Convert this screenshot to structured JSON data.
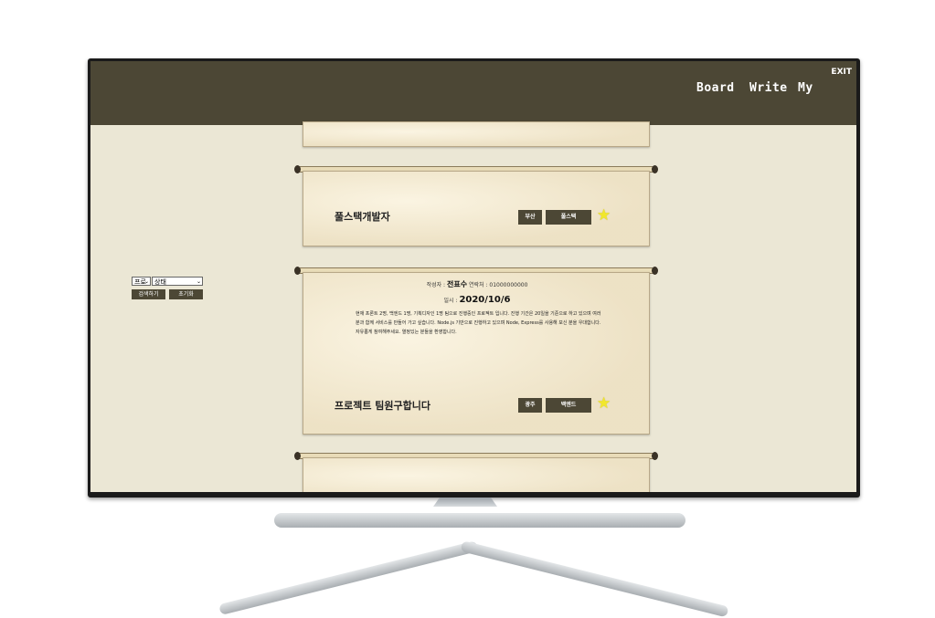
{
  "nav": {
    "board": "Board",
    "write": "Write",
    "my": "My",
    "exit": "EXIT"
  },
  "filter": {
    "select1": "프로",
    "select2": "상태",
    "search": "검색하기",
    "reset": "초기화"
  },
  "cards": [
    {
      "title": "풀스택개발자",
      "tag1": "부산",
      "tag2": "풀스택",
      "starred": true
    },
    {
      "author_label": "작성자 :",
      "author": "전표수",
      "contact": "연락처 : 01000000000",
      "date_label": "일시 :",
      "date": "2020/10/6",
      "description": "현재 프론트 2명, 백엔드 1명, 기획디자인 1명 팀으로 진행중인 프로젝트 입니다. 진행 기간은 20일을 기준으로 하고 있으며 여러분과 함께 서비스를 만들어 가고 싶습니다. Node.js 기반으로 진행하고 있으며 Node, Express를 사용해 보신 분을 우대합니다. 자유롭게 참여해주세요. 열정있는 분들을 환영합니다.",
      "title": "프로젝트 팀원구합니다",
      "tag1": "광주",
      "tag2": "백엔드",
      "starred": true
    }
  ],
  "colors": {
    "header": "#4c4735",
    "background": "#ebe7d5",
    "star": "#f1e72c"
  }
}
